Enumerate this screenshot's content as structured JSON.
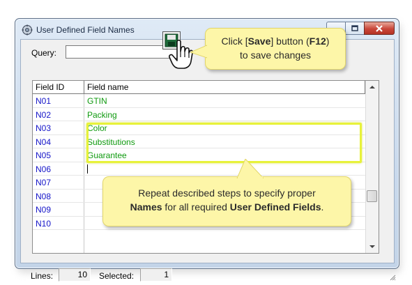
{
  "window": {
    "title": "User Defined Field Names"
  },
  "query": {
    "label": "Query:",
    "value": ""
  },
  "grid": {
    "columns": [
      "Field ID",
      "Field name"
    ],
    "rows": [
      {
        "id": "N01",
        "name": "GTIN"
      },
      {
        "id": "N02",
        "name": "Packing"
      },
      {
        "id": "N03",
        "name": "Color"
      },
      {
        "id": "N04",
        "name": "Substitutions"
      },
      {
        "id": "N05",
        "name": "Guarantee"
      },
      {
        "id": "N06",
        "name": ""
      },
      {
        "id": "N07",
        "name": ""
      },
      {
        "id": "N08",
        "name": ""
      },
      {
        "id": "N09",
        "name": ""
      },
      {
        "id": "N10",
        "name": ""
      }
    ]
  },
  "status": {
    "lines_label": "Lines:",
    "lines_value": "10",
    "selected_label": "Selected:",
    "selected_value": "1"
  },
  "callouts": {
    "save": {
      "part1": "Click [",
      "bold1": "Save",
      "part2": "] button (",
      "bold2": "F12",
      "part3": ")",
      "line2": "to save changes"
    },
    "repeat": {
      "line1": "Repeat described steps to specify proper",
      "bold1": "Names",
      "part2": " for all required ",
      "bold2": "User Defined Fields",
      "part3": "."
    }
  },
  "colors": {
    "field_id": "#1414c8",
    "field_name": "#0f9a0f",
    "highlight": "#e7f23a",
    "callout_bg": "#fdf6a8"
  },
  "icons": [
    "app-icon",
    "minimize-icon",
    "maximize-icon",
    "close-icon",
    "save-icon",
    "hand-cursor-icon",
    "resize-grip-icon"
  ]
}
